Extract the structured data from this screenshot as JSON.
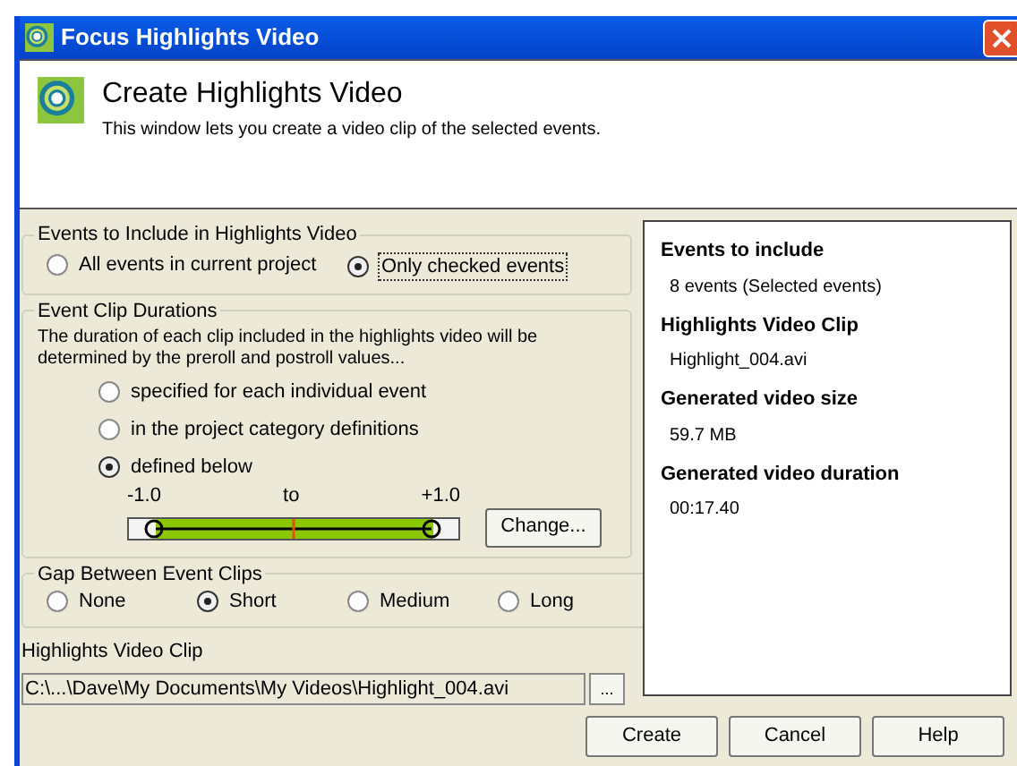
{
  "window": {
    "title": "Focus Highlights Video"
  },
  "header": {
    "title": "Create Highlights Video",
    "subtitle": "This window lets you create a video clip of the selected events."
  },
  "events_group": {
    "title": "Events to Include in Highlights Video",
    "options": [
      {
        "label": "All events in current project",
        "selected": false
      },
      {
        "label": "Only checked events",
        "selected": true
      }
    ]
  },
  "durations_group": {
    "title": "Event Clip Durations",
    "description": "The duration of each clip included in the highlights video will be determined by the preroll and postroll values...",
    "options": [
      {
        "label": "specified for each individual event",
        "selected": false
      },
      {
        "label": "in the project category definitions",
        "selected": false
      },
      {
        "label": "defined below",
        "selected": true
      }
    ],
    "range": {
      "min_label": "-1.0",
      "mid_label": "to",
      "max_label": "+1.0"
    },
    "change_button": "Change..."
  },
  "gap_group": {
    "title": "Gap Between Event Clips",
    "options": [
      {
        "label": "None",
        "selected": false
      },
      {
        "label": "Short",
        "selected": true
      },
      {
        "label": "Medium",
        "selected": false
      },
      {
        "label": "Long",
        "selected": false
      }
    ]
  },
  "clip_field": {
    "label": "Highlights Video Clip",
    "value": "C:\\...\\Dave\\My Documents\\My Videos\\Highlight_004.avi",
    "browse_button": "..."
  },
  "summary": [
    {
      "heading": "Events to include",
      "value": "8 events (Selected  events)"
    },
    {
      "heading": "Highlights Video Clip",
      "value": "Highlight_004.avi"
    },
    {
      "heading": "Generated video size",
      "value": "59.7 MB"
    },
    {
      "heading": "Generated video duration",
      "value": "00:17.40"
    }
  ],
  "buttons": [
    "Create",
    "Cancel",
    "Help"
  ]
}
